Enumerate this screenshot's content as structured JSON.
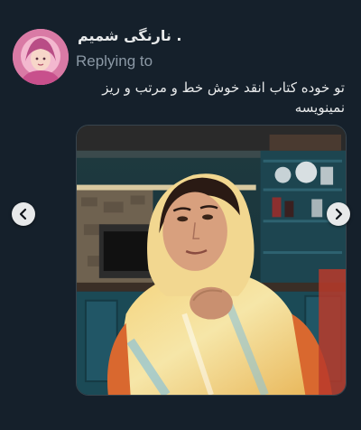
{
  "tweet": {
    "display_name": "نارنگی شمیم .",
    "replying_label": "Replying to",
    "text_line1": "تو خوده کتاب انقد خوش خط و مرتب و ریز",
    "text_line2": "نمینویسه"
  },
  "media": {
    "kind": "photo",
    "carousel": {
      "prev_icon": "chevron-left-icon",
      "next_icon": "chevron-right-icon"
    }
  },
  "colors": {
    "background": "#15202b",
    "primary_text": "#e7e9ea",
    "secondary_text": "#8b98a5",
    "border": "#38444d",
    "nav_button": "#e7e9ea"
  }
}
